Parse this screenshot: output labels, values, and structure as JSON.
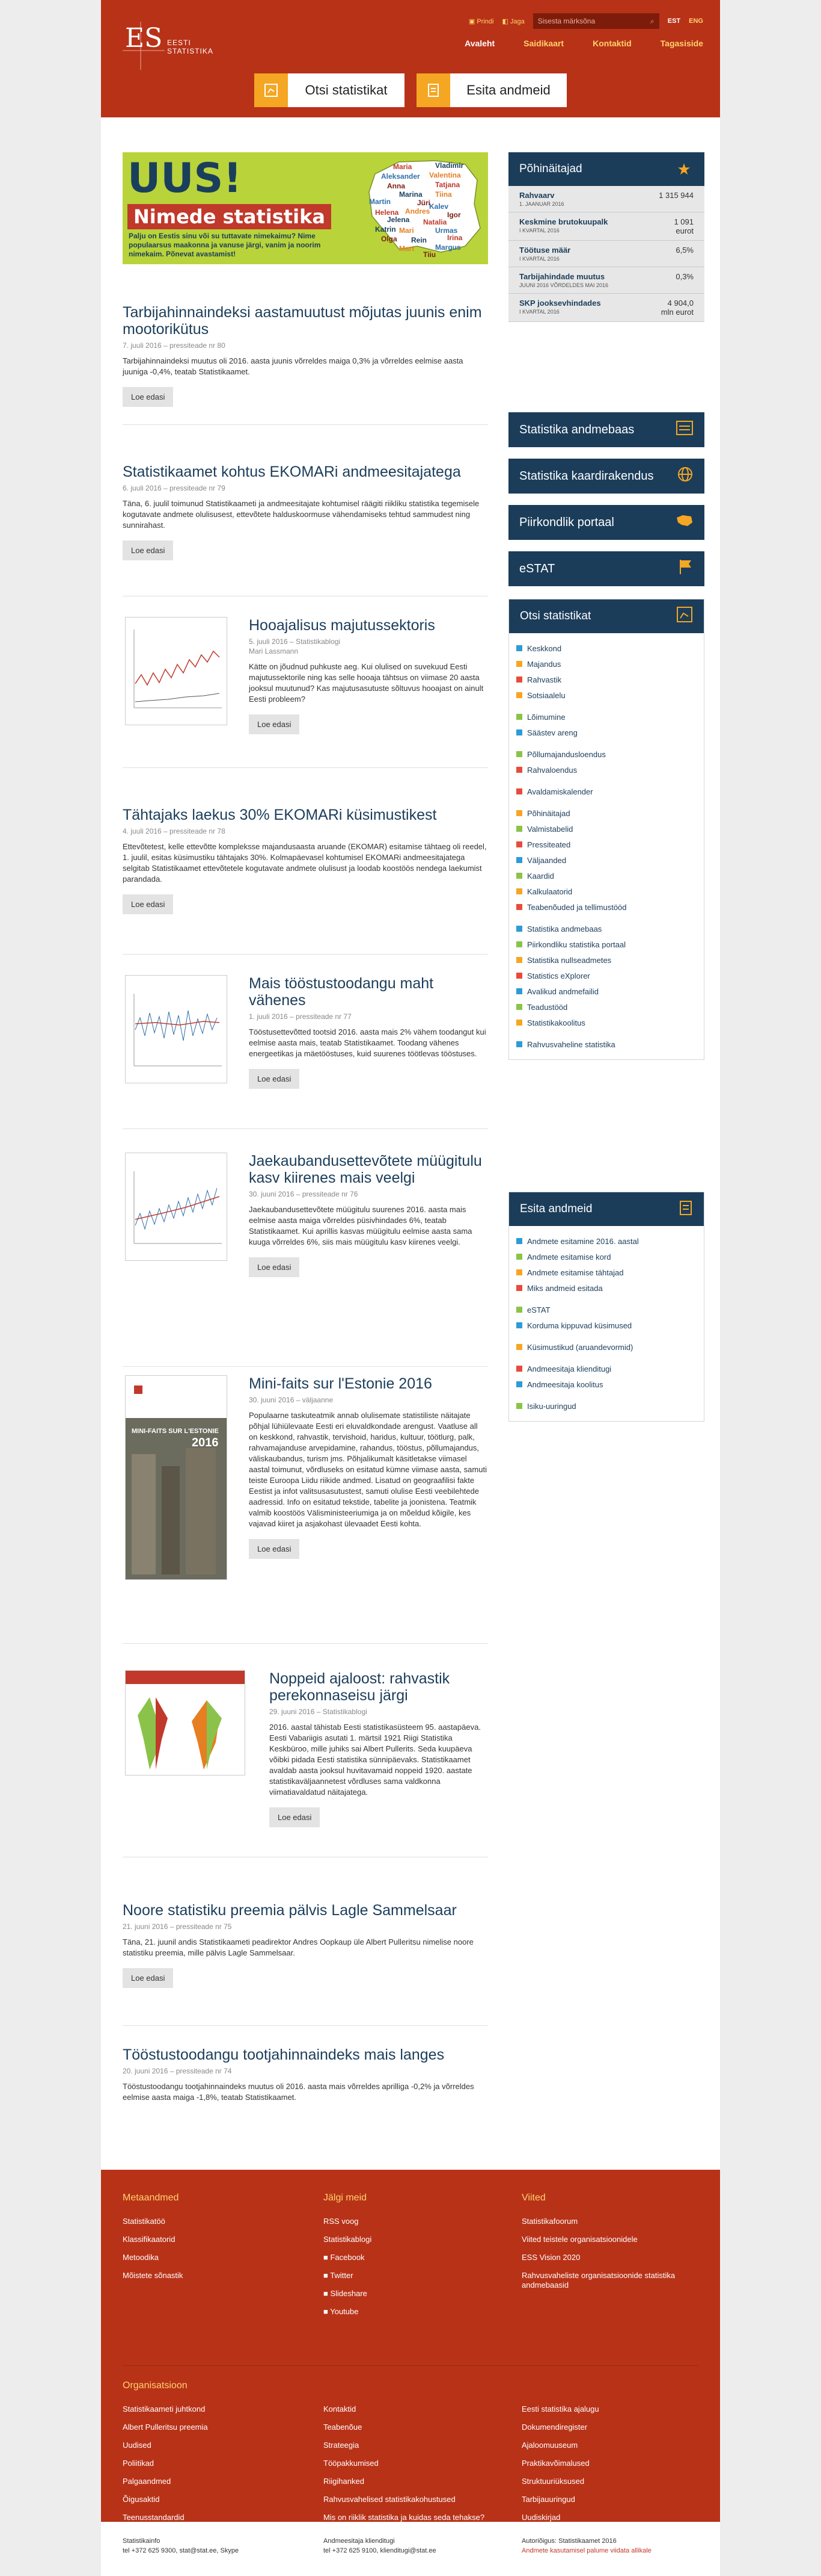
{
  "header": {
    "logo_text": "EESTI STATISTIKA",
    "print": "Prindi",
    "share": "Jaga",
    "search_placeholder": "Sisesta märksõna",
    "lang_est": "EST",
    "lang_eng": "ENG",
    "nav": [
      "Avaleht",
      "Saidikaart",
      "Kontaktid",
      "Tagasiside"
    ],
    "btn_find": "Otsi statistikat",
    "btn_submit": "Esita andmeid"
  },
  "banner": {
    "uus": "UUS!",
    "title": "Nimede statistika",
    "subtitle": "Palju on Eestis sinu või su tuttavate nimekaimu? Nime populaarsus maakonna ja vanuse järgi, vanim ja noorim nimekaim. Põnevat avastamist!",
    "names": [
      "Maria",
      "Vladimir",
      "Aleksander",
      "Valentina",
      "Anna",
      "Tatjana",
      "Marina",
      "Martin",
      "Tiina",
      "Jüri",
      "Helena",
      "Jelena",
      "Kalev",
      "Andres",
      "Igor",
      "Natalia",
      "Katrin",
      "Urmas",
      "Mari",
      "Olga",
      "Irina",
      "Rein",
      "Margus",
      "Mart",
      "Tiiu"
    ]
  },
  "articles": [
    {
      "title": "Tarbijahinnaindeksi aastamuutust mõjutas juunis enim mootorikütus",
      "meta": "7. juuli 2016 – pressiteade nr 80",
      "body": "Tarbijahinnaindeksi muutus oli 2016. aasta juunis võrreldes maiga 0,3% ja võrreldes eelmise aasta juuniga -0,4%, teatab Statistikaamet.",
      "btn": "Loe edasi"
    },
    {
      "title": "Statistikaamet kohtus EKOMARi andmeesitajatega",
      "meta": "6. juuli 2016 – pressiteade nr 79",
      "body": "Täna, 6. juulil toimunud Statistikaameti ja andmeesitajate kohtumisel räägiti riikliku statistika tegemisele kogutavate andmete olulisusest, ettevõtete halduskoormuse vähendamiseks tehtud sammudest ning sunnirahast.",
      "btn": "Loe edasi"
    },
    {
      "title": "Hooajalisus majutussektoris",
      "meta": "5. juuli 2016 – Statistikablogi",
      "meta2": "Mari Lassmann",
      "body": "Kätte on jõudnud puhkuste aeg. Kui olulised on suvekuud Eesti majutussektorile ning kas selle hooaja tähtsus on viimase 20 aasta jooksul muutunud? Kas majutusasutuste sõltuvus hooajast on ainult Eesti probleem?",
      "btn": "Loe edasi"
    },
    {
      "title": "Tähtajaks laekus 30% EKOMARi küsimustikest",
      "meta": "4. juuli 2016 – pressiteade nr 78",
      "body": "Ettevõtetest, kelle ettevõtte kompleksse majandusaasta aruande (EKOMAR) esitamise tähtaeg oli reedel, 1. juulil, esitas küsimustiku tähtajaks 30%. Kolmapäevasel kohtumisel EKOMARi andmeesitajatega selgitab Statistikaamet ettevõtetele kogutavate andmete olulisust ja loodab koostöös nendega laekumist parandada.",
      "btn": "Loe edasi"
    },
    {
      "title": "Mais tööstustoodangu maht vähenes",
      "meta": "1. juuli 2016 – pressiteade nr 77",
      "body": "Tööstusettevõtted tootsid 2016. aasta mais 2% vähem toodangut kui eelmise aasta mais, teatab Statistikaamet. Toodang vähenes energeetikas ja mäetööstuses, kuid suurenes töötlevas tööstuses.",
      "btn": "Loe edasi"
    },
    {
      "title": "Jaekaubandusettevõtete müügitulu kasv kiirenes mais veelgi",
      "meta": "30. juuni 2016 – pressiteade nr 76",
      "body": "Jaekaubandusettevõtete müügitulu suurenes 2016. aasta mais eelmise aasta maiga võrreldes püsivhindades 6%, teatab Statistikaamet. Kui aprillis kasvas müügitulu eelmise aasta sama kuuga võrreldes 6%, siis mais müügitulu kasv kiirenes veelgi.",
      "btn": "Loe edasi"
    },
    {
      "title": "Mini-faits sur l'Estonie 2016",
      "meta": "30. juuni 2016 – väljaanne",
      "body": "Populaarne taskuteatmik annab olulisemate statistiliste näitajate põhjal lühiülevaate Eesti eri eluvaldkondade arengust. Vaatluse all on keskkond, rahvastik, tervishoid, haridus, kultuur, töötlurg, palk, rahvamajanduse arvepidamine, rahandus, tööstus, põllumajandus, väliskaubandus, turism jms. Põhjalikumalt käsitletakse viimasel aastal toimunut, võrdluseks on esitatud kümne viimase aasta, samuti teiste Euroopa Liidu riikide andmed. Lisatud on geograafilisi fakte Eestist ja infot valitsusasutustest, samuti olulise Eesti veebilehtede aadressid. Info on esitatud tekstide, tabelite ja joonistena. Teatmik valmib koostöös Välisministeeriumiga ja on mõeldud kõigile, kes vajavad kiiret ja asjakohast ülevaadet Eesti kohta.",
      "btn": "Loe edasi",
      "cover_title": "MINI-FAITS SUR L'ESTONIE",
      "cover_year": "2016"
    },
    {
      "title": "Noppeid ajaloost: rahvastik perekonnaseisu järgi",
      "meta": "29. juuni 2016 – Statistikablogi",
      "body": "2016. aastal tähistab Eesti statistikasüsteem 95. aastapäeva. Eesti Vabariigis asutati 1. märtsil 1921 Riigi Statistika Keskbüroo, mille juhiks sai Albert Pullerits. Seda kuupäeva võibki pidada Eesti statistika sünnipäevaks. Statistikaamet avaldab aasta jooksul huvitavamaid noppeid 1920. aastate statistikaväljaannetest võrdluses sama valdkonna viimatiavaldatud näitajatega.",
      "btn": "Loe edasi"
    },
    {
      "title": "Noore statistiku preemia pälvis Lagle Sammelsaar",
      "meta": "21. juuni 2016 – pressiteade nr 75",
      "body": "Täna, 21. juunil andis Statistikaameti peadirektor Andres Oopkaup üle Albert Pulleritsu nimelise noore statistiku preemia, mille pälvis Lagle Sammelsaar.",
      "btn": "Loe edasi"
    },
    {
      "title": "Tööstustoodangu tootjahinnaindeks mais langes",
      "meta": "20. juuni 2016 – pressiteade nr 74",
      "body": "Tööstustoodangu tootjahinnaindeks muutus oli 2016. aasta mais võrreldes aprilliga -0,2% ja võrreldes eelmise aasta maiga -1,8%, teatab Statistikaamet.",
      "btn": ""
    }
  ],
  "indicators": {
    "title": "Põhinäitajad",
    "rows": [
      {
        "label": "Rahvaarv",
        "sub": "1. JAANUAR 2016",
        "value": "1 315 944",
        "unit": ""
      },
      {
        "label": "Keskmine brutokuupalk",
        "sub": "I KVARTAL 2016",
        "value": "1 091",
        "unit": "eurot"
      },
      {
        "label": "Töötuse määr",
        "sub": "I KVARTAL 2016",
        "value": "6,5%",
        "unit": ""
      },
      {
        "label": "Tarbijahindade muutus",
        "sub": "JUUNI 2016 VÕRDELDES MAI 2016",
        "value": "0,3%",
        "unit": ""
      },
      {
        "label": "SKP jooksevhindades",
        "sub": "I KVARTAL 2016",
        "value": "4 904,0",
        "unit": "mln eurot"
      }
    ]
  },
  "tiles": [
    "Statistika andmebaas",
    "Statistika kaardirakendus",
    "Piirkondlik portaal",
    "eSTAT"
  ],
  "find_stats": {
    "title": "Otsi statistikat",
    "groups": [
      [
        {
          "t": "Keskkond",
          "c": "#2f9ad6"
        },
        {
          "t": "Majandus",
          "c": "#f5a623"
        },
        {
          "t": "Rahvastik",
          "c": "#e64c3c"
        },
        {
          "t": "Sotsiaalelu",
          "c": "#f5a623"
        }
      ],
      [
        {
          "t": "Lõimumine",
          "c": "#8bc34a"
        },
        {
          "t": "Säästev areng",
          "c": "#2f9ad6"
        }
      ],
      [
        {
          "t": "Põllumajandusloendus",
          "c": "#8bc34a"
        },
        {
          "t": "Rahvaloendus",
          "c": "#e64c3c"
        }
      ],
      [
        {
          "t": "Avaldamiskalender",
          "c": "#e64c3c"
        }
      ],
      [
        {
          "t": "Põhinäitajad",
          "c": "#f5a623"
        },
        {
          "t": "Valmistabelid",
          "c": "#8bc34a"
        },
        {
          "t": "Pressiteated",
          "c": "#e64c3c"
        },
        {
          "t": "Väljaanded",
          "c": "#2f9ad6"
        },
        {
          "t": "Kaardid",
          "c": "#8bc34a"
        },
        {
          "t": "Kalkulaatorid",
          "c": "#f5a623"
        },
        {
          "t": "Teabenõuded ja tellimustööd",
          "c": "#e64c3c"
        }
      ],
      [
        {
          "t": "Statistika andmebaas",
          "c": "#2f9ad6"
        },
        {
          "t": "Piirkondliku statistika portaal",
          "c": "#8bc34a"
        },
        {
          "t": "Statistika nullseadmetes",
          "c": "#f5a623"
        },
        {
          "t": "Statistics eXplorer",
          "c": "#e64c3c"
        },
        {
          "t": "Avalikud andmefailid",
          "c": "#2f9ad6"
        },
        {
          "t": "Teadustööd",
          "c": "#8bc34a"
        },
        {
          "t": "Statistikakoolitus",
          "c": "#f5a623"
        }
      ],
      [
        {
          "t": "Rahvusvaheline statistika",
          "c": "#2f9ad6"
        }
      ]
    ]
  },
  "submit_data": {
    "title": "Esita andmeid",
    "groups": [
      [
        {
          "t": "Andmete esitamine 2016. aastal",
          "c": "#2f9ad6"
        },
        {
          "t": "Andmete esitamise kord",
          "c": "#8bc34a"
        },
        {
          "t": "Andmete esitamise tähtajad",
          "c": "#f5a623"
        },
        {
          "t": "Miks andmeid esitada",
          "c": "#e64c3c"
        }
      ],
      [
        {
          "t": "eSTAT",
          "c": "#8bc34a"
        },
        {
          "t": "Korduma kippuvad küsimused",
          "c": "#2f9ad6"
        }
      ],
      [
        {
          "t": "Küsimustikud (aruandevormid)",
          "c": "#f5a623"
        }
      ],
      [
        {
          "t": "Andmeesitaja klienditugi",
          "c": "#e64c3c"
        },
        {
          "t": "Andmeesitaja koolitus",
          "c": "#2f9ad6"
        }
      ],
      [
        {
          "t": "Isiku-uuringud",
          "c": "#8bc34a"
        }
      ]
    ]
  },
  "footer": {
    "col1": {
      "title": "Metaandmed",
      "items": [
        "Statistikatöö",
        "Klassifikaatorid",
        "Metoodika",
        "Mõistete sõnastik"
      ]
    },
    "col2": {
      "title": "Jälgi meid",
      "items": [
        "RSS voog",
        "Statistikablogi",
        "Facebook",
        "Twitter",
        "Slideshare",
        "Youtube"
      ]
    },
    "col3": {
      "title": "Viited",
      "items": [
        "Statistikafoorum",
        "Viited teistele organisatsioonidele",
        "ESS Vision 2020",
        "Rahvusvaheliste organisatsioonide statistika andmebaasid"
      ]
    },
    "org_title": "Organisatsioon",
    "org1": [
      "Statistikaameti juhtkond",
      "Albert Pulleritsu preemia",
      "Uudised",
      "Poliitikad",
      "Palgaandmed",
      "Õigusaktid",
      "Teenusstandardid"
    ],
    "org2": [
      "Kontaktid",
      "Teabenõue",
      "Strateegia",
      "Tööpakkumised",
      "Riigihanked",
      "Rahvusvahelised statistikakohustused",
      "Mis on riiklik statistika ja kuidas seda tehakse?"
    ],
    "org3": [
      "Eesti statistika ajalugu",
      "Dokumendiregister",
      "Ajaloomuuseum",
      "Praktikavõimalused",
      "Struktuuriüksused",
      "Tarbijauuringud",
      "Uudiskirjad"
    ]
  },
  "bottom": {
    "c1_title": "Statistikainfo",
    "c1_line": "tel +372 625 9300, stat@stat.ee, Skype",
    "c2_title": "Andmeesitaja klienditugi",
    "c2_line": "tel +372 625 9100, klienditugi@stat.ee",
    "c3_title": "Autoriõigus: Statistikaamet 2016",
    "c3_line": "Andmete kasutamisel palume viidata allikale"
  }
}
